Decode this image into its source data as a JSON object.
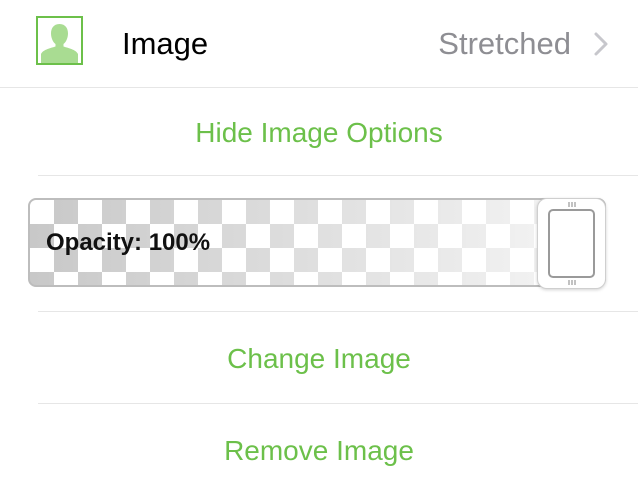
{
  "header": {
    "title": "Image",
    "value": "Stretched",
    "thumbnail_icon": "person-silhouette-icon",
    "chevron_icon": "chevron-right-icon"
  },
  "options_toggle": {
    "label": "Hide Image Options"
  },
  "opacity": {
    "label": "Opacity: 100%",
    "value": 1.0
  },
  "actions": {
    "change_label": "Change Image",
    "remove_label": "Remove Image"
  },
  "colors": {
    "accent": "#6cc04a",
    "secondary_text": "#8e8e93",
    "divider": "#e6e6e6"
  }
}
